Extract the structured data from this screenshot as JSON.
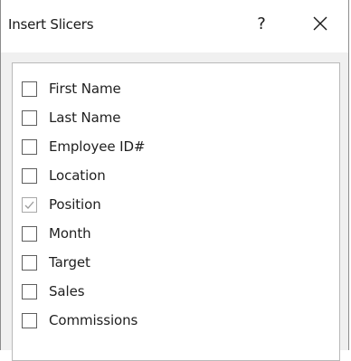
{
  "dialog": {
    "title": "Insert Slicers",
    "help_label": "?"
  },
  "fields": [
    {
      "label": "First Name",
      "checked": false
    },
    {
      "label": "Last Name",
      "checked": false
    },
    {
      "label": "Employee ID#",
      "checked": false
    },
    {
      "label": "Location",
      "checked": false
    },
    {
      "label": "Position",
      "checked": true
    },
    {
      "label": "Month",
      "checked": false
    },
    {
      "label": "Target",
      "checked": false
    },
    {
      "label": "Sales",
      "checked": false
    },
    {
      "label": "Commissions",
      "checked": false
    }
  ],
  "colors": {
    "checkmark": "#9a9a9a"
  }
}
